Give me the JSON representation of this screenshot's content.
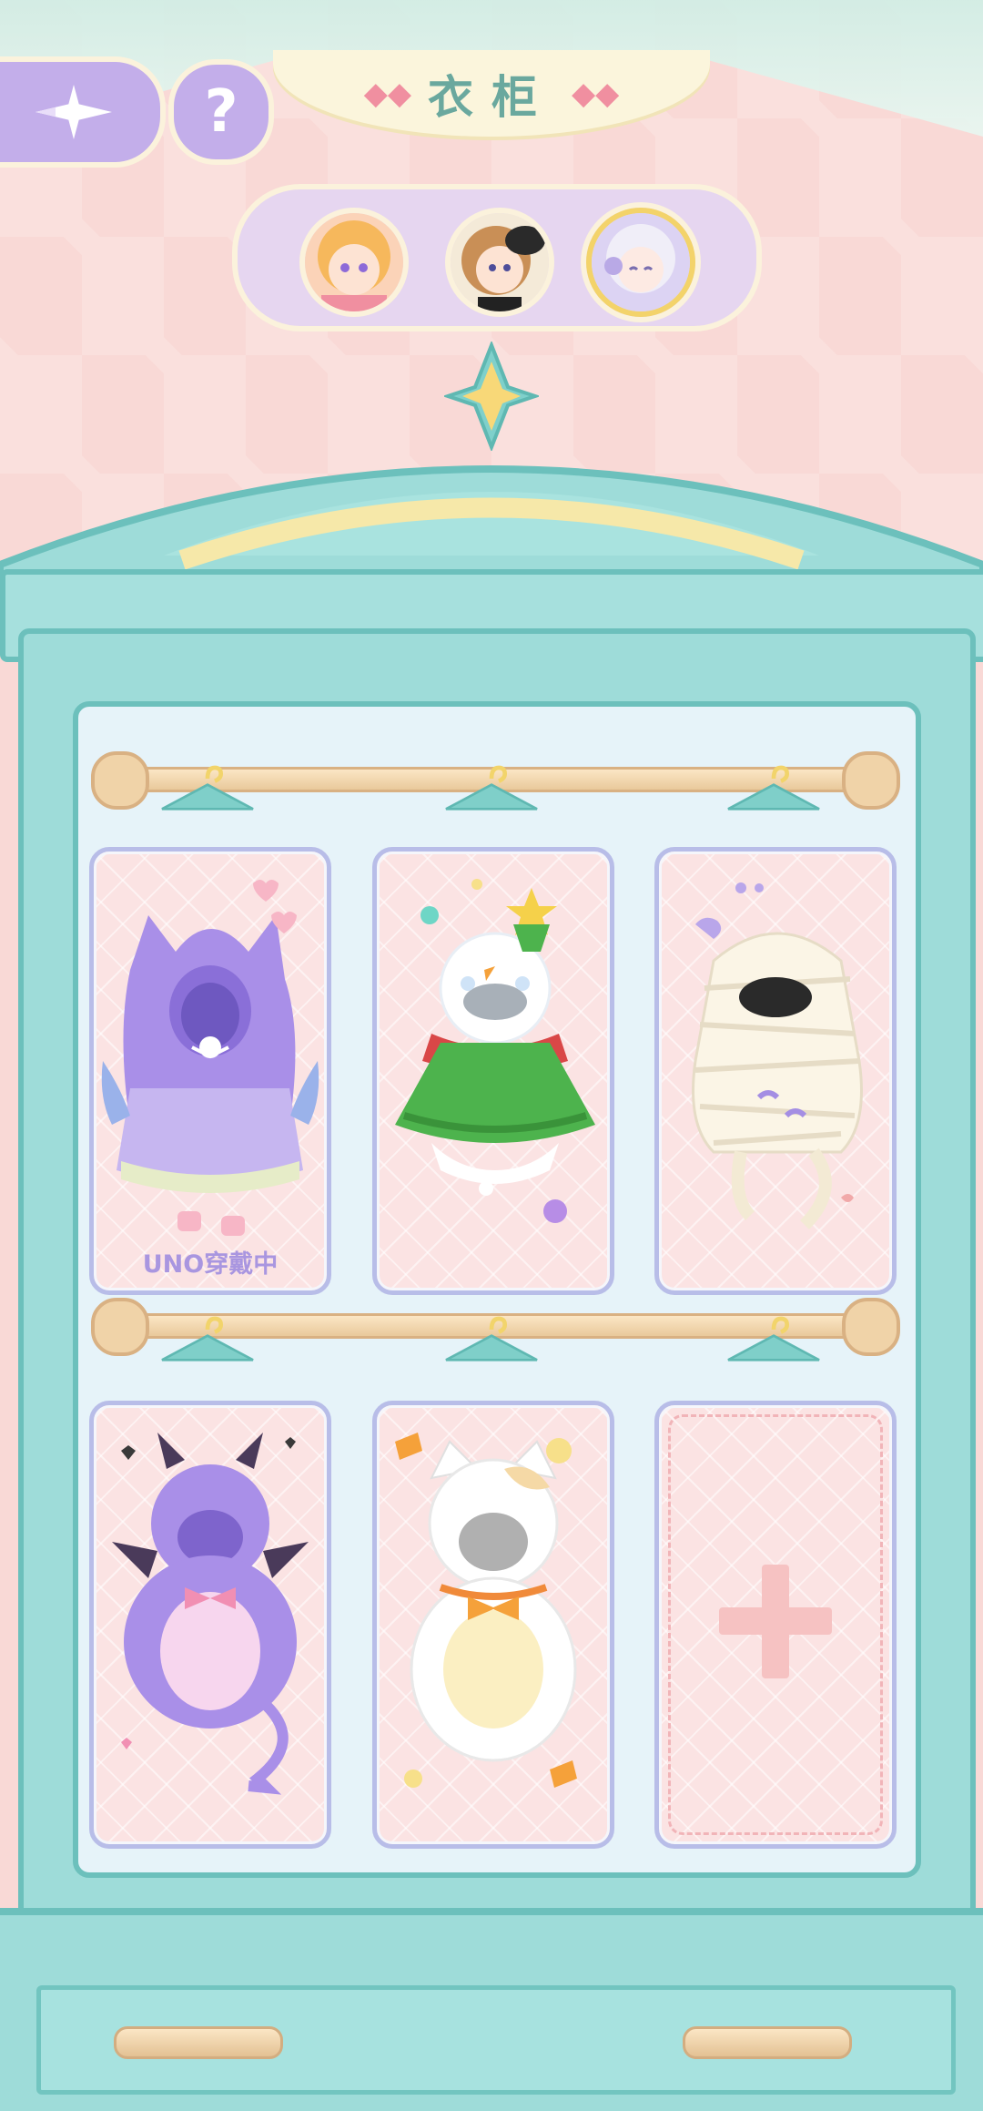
{
  "header": {
    "title": "衣柜",
    "back_icon": "compass-star-back-icon",
    "help_label": "?"
  },
  "characters": [
    {
      "name": "character-blonde-girl",
      "selected": false
    },
    {
      "name": "character-brown-hair-hat",
      "selected": false
    },
    {
      "name": "character-white-hair-uno",
      "selected": true
    }
  ],
  "wardrobe": {
    "rows": [
      {
        "items": [
          {
            "costume": "purple-cat-hoodie",
            "status": "UNO穿戴中"
          },
          {
            "costume": "snowman-christmas-tree"
          },
          {
            "costume": "mummy-bandage"
          }
        ]
      },
      {
        "items": [
          {
            "costume": "purple-devil-onesie"
          },
          {
            "costume": "white-cat-bow"
          },
          {
            "costume": "empty-slot-add"
          }
        ]
      }
    ]
  },
  "colors": {
    "accent_purple": "#c3aeea",
    "wardrobe_teal": "#9edcd9",
    "card_pink": "#fbe3e3",
    "title_teal": "#6aa89e"
  }
}
